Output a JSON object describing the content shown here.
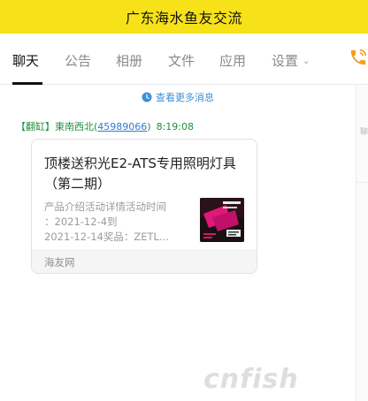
{
  "window": {
    "title": "广东海水鱼友交流"
  },
  "tabs": [
    {
      "label": "聊天",
      "active": true
    },
    {
      "label": "公告"
    },
    {
      "label": "相册"
    },
    {
      "label": "文件"
    },
    {
      "label": "应用"
    },
    {
      "label": "设置"
    }
  ],
  "colors": {
    "titlebar": "#f7e21a",
    "link": "#3d8fd6",
    "sender": "#1f8f3e",
    "phone": "#f0a020"
  },
  "icons": {
    "more": "clock-icon",
    "settings_dropdown": "chevron-down-icon",
    "call": "phone-icon"
  },
  "chat": {
    "more_messages": "查看更多消息",
    "message": {
      "sender_tag": "【翻缸】",
      "sender_name": "東南西北",
      "sender_id_open": "(",
      "sender_id": "45989066",
      "sender_id_close": ")",
      "time": "8:19:08",
      "card": {
        "title": "顶楼送积光E2-ATS专用照明灯具（第二期）",
        "desc_lines": [
          "产品介绍活动详情活动时间",
          "：2021-12-4到",
          "2021-12-14奖品：ZETL..."
        ],
        "source": "海友网"
      }
    }
  },
  "side_panel": {
    "char": "聊"
  },
  "watermark": "cnfish"
}
